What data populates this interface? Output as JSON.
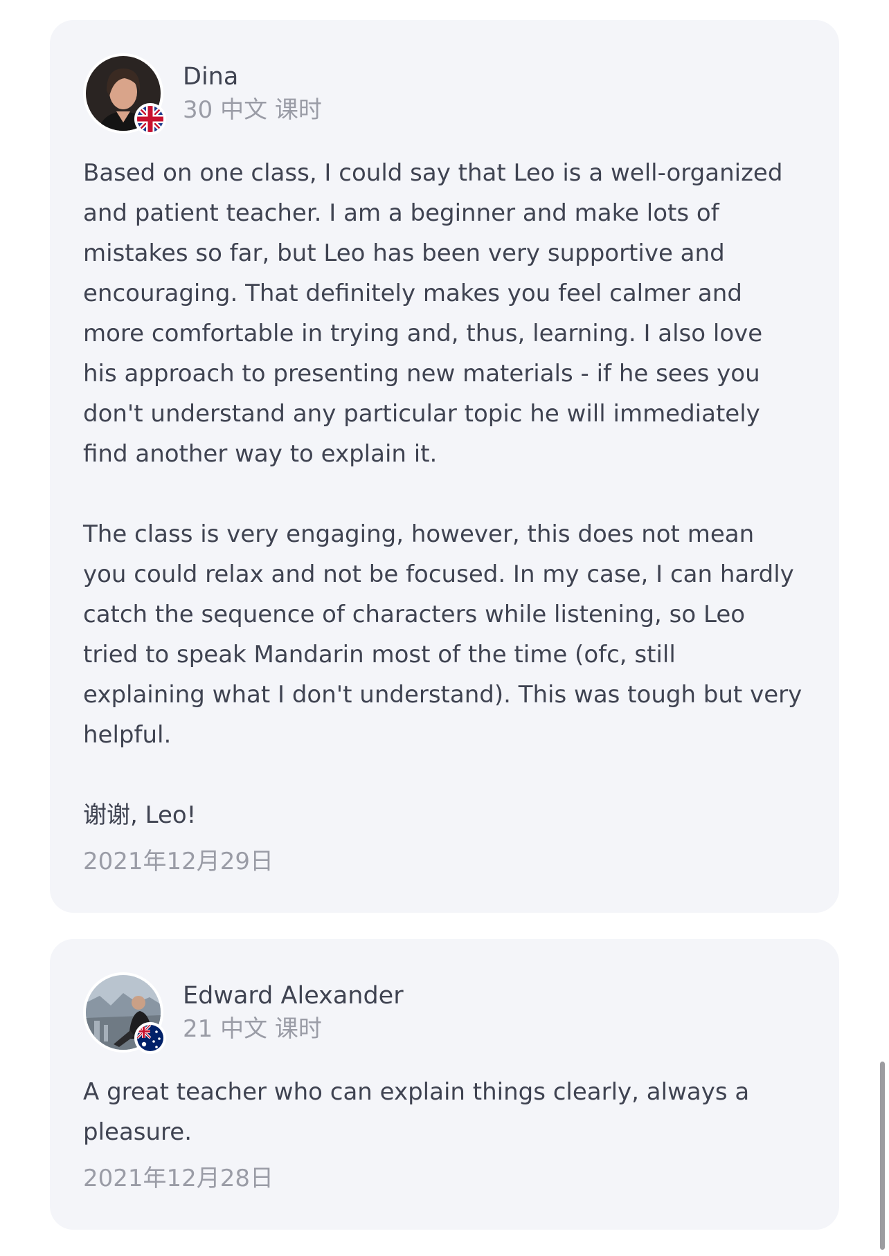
{
  "reviews": [
    {
      "name": "Dina",
      "lessons": "30 中文 课时",
      "flag": "uk-flag",
      "text": "Based on one class, I could say that Leo is a well-organized and patient teacher. I am a beginner and make lots of mistakes so far, but Leo has been very supportive and encouraging. That definitely makes you feel calmer and more comfortable in trying and, thus, learning. I also love his approach to presenting new materials - if he sees you don't understand any particular topic he will immediately find another way to explain it.\n\nThe class is very engaging, however, this does not mean you could relax and not be focused. In my case, I can hardly catch the sequence of characters while listening, so Leo tried to speak Mandarin most of the time (ofc, still explaining what I don't understand). This was tough but very helpful.\n\n谢谢, Leo!",
      "date": "2021年12月29日"
    },
    {
      "name": "Edward Alexander",
      "lessons": "21 中文 课时",
      "flag": "australia-flag",
      "text": "A great teacher who can explain things clearly, always a pleasure.",
      "date": "2021年12月28日"
    }
  ]
}
